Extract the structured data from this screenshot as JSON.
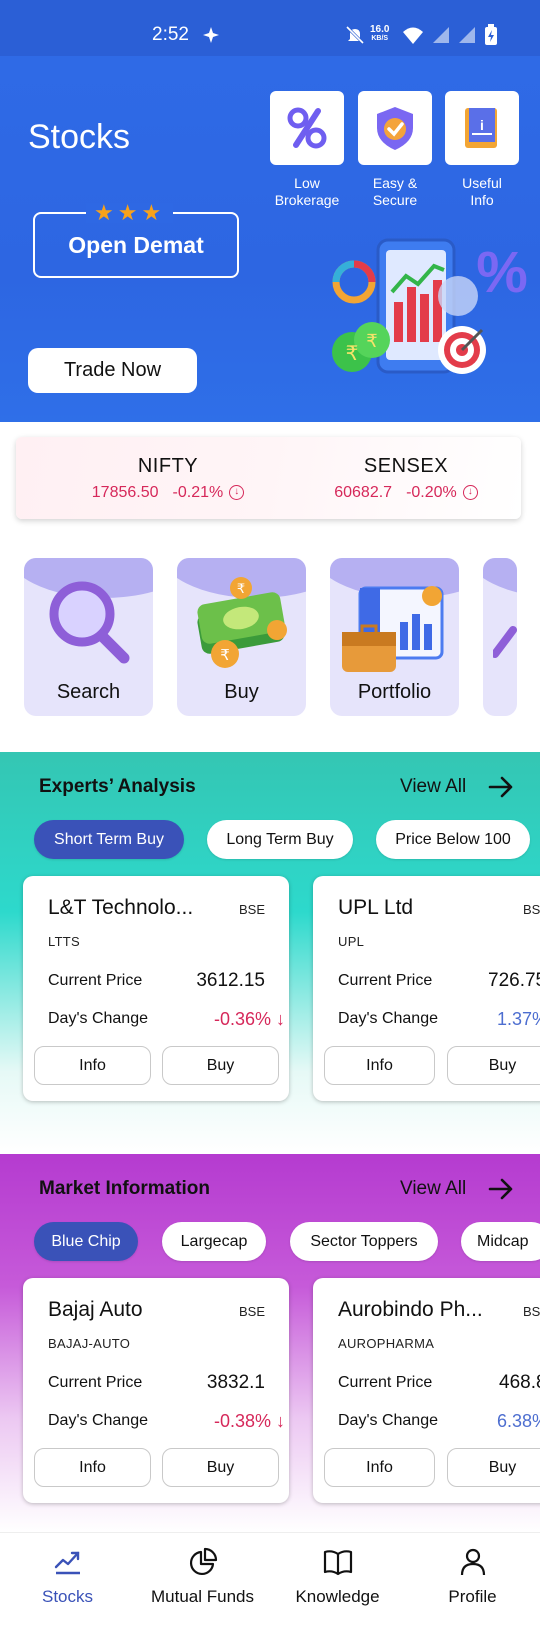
{
  "status_bar": {
    "time": "2:52",
    "speed_value": "16.0",
    "speed_unit": "KB/S",
    "icons": [
      "mute-icon",
      "wifi-icon",
      "no-sim-icon",
      "no-sim-icon",
      "battery-charging-icon"
    ]
  },
  "hero": {
    "title": "Stocks",
    "features": [
      {
        "label_line1": "Low",
        "label_line2": "Brokerage",
        "icon": "percent-icon"
      },
      {
        "label_line1": "Easy &",
        "label_line2": "Secure",
        "icon": "shield-check-icon"
      },
      {
        "label_line1": "Useful",
        "label_line2": "Info",
        "icon": "info-book-icon"
      }
    ],
    "demat_label": "Open Demat",
    "stars": "★★★",
    "trade_button": "Trade Now"
  },
  "indices": [
    {
      "name": "NIFTY",
      "value": "17856.50",
      "change": "-0.21%"
    },
    {
      "name": "SENSEX",
      "value": "60682.7",
      "change": "-0.20%"
    }
  ],
  "quick_actions": [
    {
      "label": "Search",
      "icon": "magnifier-icon"
    },
    {
      "label": "Buy",
      "icon": "money-stack-icon"
    },
    {
      "label": "Portfolio",
      "icon": "briefcase-chart-icon"
    }
  ],
  "experts": {
    "title": "Experts’ Analysis",
    "view_all": "View All",
    "chips": [
      "Short Term Buy",
      "Long Term Buy",
      "Price Below 100"
    ],
    "cards": [
      {
        "name": "L&T Technolo...",
        "exchange": "BSE",
        "symbol": "LTTS",
        "price_label": "Current Price",
        "price": "3612.15",
        "change_label": "Day's Change",
        "change": "-0.36% ↓",
        "info": "Info",
        "buy": "Buy"
      },
      {
        "name": "UPL Ltd",
        "exchange": "BS",
        "symbol": "UPL",
        "price_label": "Current Price",
        "price": "726.75",
        "change_label": "Day's Change",
        "change": "1.37%",
        "info": "Info",
        "buy": "Buy"
      }
    ]
  },
  "market": {
    "title": "Market Information",
    "view_all": "View All",
    "chips": [
      "Blue Chip",
      "Largecap",
      "Sector Toppers",
      "Midcap"
    ],
    "cards": [
      {
        "name": "Bajaj Auto",
        "exchange": "BSE",
        "symbol": "BAJAJ-AUTO",
        "price_label": "Current Price",
        "price": "3832.1",
        "change_label": "Day's Change",
        "change": "-0.38% ↓",
        "info": "Info",
        "buy": "Buy"
      },
      {
        "name": "Aurobindo Ph...",
        "exchange": "BS",
        "symbol": "AUROPHARMA",
        "price_label": "Current Price",
        "price": "468.8",
        "change_label": "Day's Change",
        "change": "6.38%",
        "info": "Info",
        "buy": "Buy"
      }
    ]
  },
  "bottom_nav": [
    {
      "label": "Stocks",
      "icon": "stock-chart-icon",
      "active": true
    },
    {
      "label": "Mutual Funds",
      "icon": "pie-chart-icon",
      "active": false
    },
    {
      "label": "Knowledge",
      "icon": "book-icon",
      "active": false
    },
    {
      "label": "Profile",
      "icon": "person-icon",
      "active": false
    }
  ],
  "colors": {
    "brand_blue": "#2d66e2",
    "negative": "#d6285a",
    "positive": "#4d6ed0",
    "active_chip": "#3a52b8",
    "star": "#f7a21b"
  }
}
